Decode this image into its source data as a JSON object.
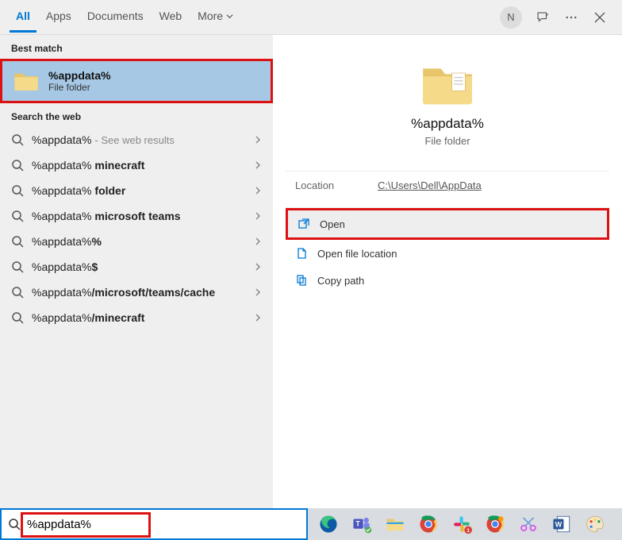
{
  "tabs": {
    "all": "All",
    "apps": "Apps",
    "documents": "Documents",
    "web": "Web",
    "more": "More"
  },
  "avatar_initial": "N",
  "sections": {
    "best_match": "Best match",
    "search_web": "Search the web"
  },
  "best_match": {
    "title": "%appdata%",
    "subtitle": "File folder"
  },
  "suggestions": [
    {
      "text": "%appdata%",
      "hint": "- See web results",
      "bold": ""
    },
    {
      "text": "%appdata% ",
      "bold": "minecraft",
      "hint": ""
    },
    {
      "text": "%appdata% ",
      "bold": "folder",
      "hint": ""
    },
    {
      "text": "%appdata% ",
      "bold": "microsoft teams",
      "hint": ""
    },
    {
      "text": "%appdata%",
      "bold": "%",
      "hint": ""
    },
    {
      "text": "%appdata%",
      "bold": "$",
      "hint": ""
    },
    {
      "text": "%appdata%",
      "bold": "/microsoft/teams/cache",
      "hint": ""
    },
    {
      "text": "%appdata%",
      "bold": "/minecraft",
      "hint": ""
    }
  ],
  "details": {
    "title": "%appdata%",
    "subtitle": "File folder",
    "location_label": "Location",
    "location_value": "C:\\Users\\Dell\\AppData"
  },
  "actions": {
    "open": "Open",
    "open_location": "Open file location",
    "copy_path": "Copy path"
  },
  "search_input": "%appdata%"
}
